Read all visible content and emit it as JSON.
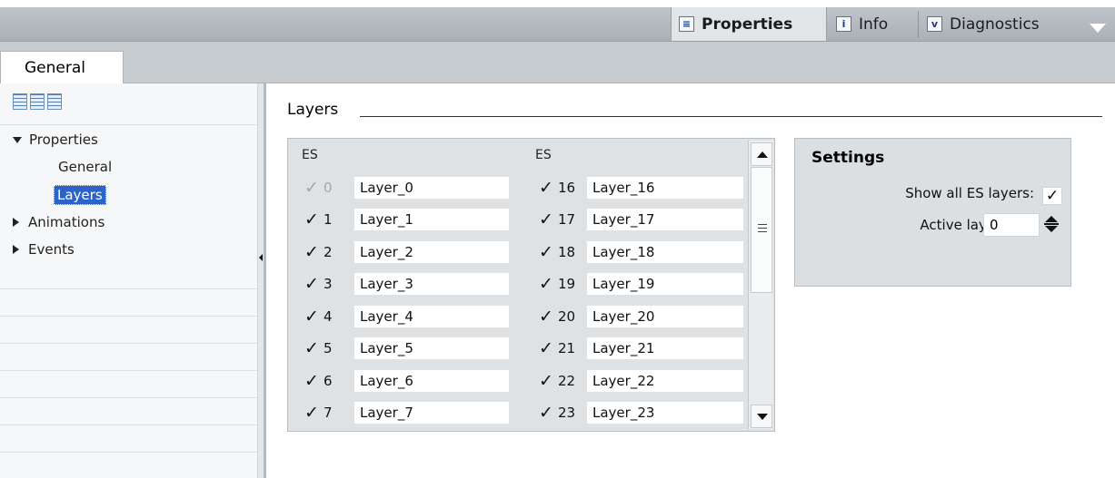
{
  "top_tabs": [
    {
      "label": "Properties",
      "icon": "properties-icon",
      "active": true
    },
    {
      "label": "Info",
      "icon": "info-icon",
      "active": false
    },
    {
      "label": "Diagnostics",
      "icon": "diagnostics-icon",
      "active": false
    }
  ],
  "sub_tab": {
    "label": "General"
  },
  "nav": {
    "items": [
      {
        "label": "Properties",
        "expanded": true
      },
      {
        "label": "General"
      },
      {
        "label": "Layers",
        "selected": true
      },
      {
        "label": "Animations",
        "expanded": false
      },
      {
        "label": "Events",
        "expanded": false
      }
    ]
  },
  "section": {
    "title": "Layers"
  },
  "layers": {
    "col_header_left": "ES",
    "col_header_right": "ES",
    "left": [
      {
        "num": "0",
        "name": "Layer_0",
        "checked": true,
        "disabled": true
      },
      {
        "num": "1",
        "name": "Layer_1",
        "checked": true
      },
      {
        "num": "2",
        "name": "Layer_2",
        "checked": true
      },
      {
        "num": "3",
        "name": "Layer_3",
        "checked": true
      },
      {
        "num": "4",
        "name": "Layer_4",
        "checked": true
      },
      {
        "num": "5",
        "name": "Layer_5",
        "checked": true
      },
      {
        "num": "6",
        "name": "Layer_6",
        "checked": true
      },
      {
        "num": "7",
        "name": "Layer_7",
        "checked": true
      }
    ],
    "right": [
      {
        "num": "16",
        "name": "Layer_16",
        "checked": true
      },
      {
        "num": "17",
        "name": "Layer_17",
        "checked": true
      },
      {
        "num": "18",
        "name": "Layer_18",
        "checked": true
      },
      {
        "num": "19",
        "name": "Layer_19",
        "checked": true
      },
      {
        "num": "20",
        "name": "Layer_20",
        "checked": true
      },
      {
        "num": "21",
        "name": "Layer_21",
        "checked": true
      },
      {
        "num": "22",
        "name": "Layer_22",
        "checked": true
      },
      {
        "num": "23",
        "name": "Layer_23",
        "checked": true
      }
    ]
  },
  "settings": {
    "title": "Settings",
    "show_all_label": "Show all ES layers:",
    "show_all_checked": true,
    "active_layer_label": "Active layer:",
    "active_layer_value": "0"
  },
  "colors": {
    "selection": "#2a64c8",
    "panel": "#dfe2e4"
  }
}
